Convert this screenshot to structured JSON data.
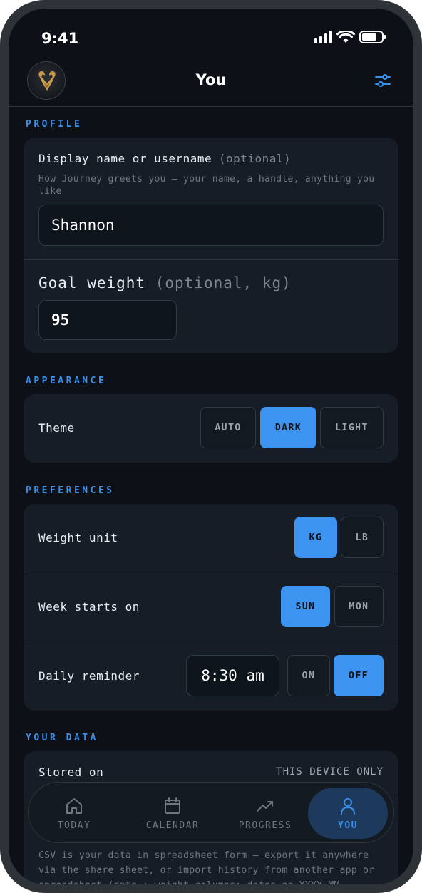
{
  "status_bar": {
    "time": "9:41"
  },
  "header": {
    "title": "You"
  },
  "profile": {
    "section_label": "PROFILE",
    "display_name_label": "Display name or username",
    "display_name_optional": "(optional)",
    "display_name_helper": "How Journey greets you — your name, a handle, anything you like",
    "display_name_value": "Shannon",
    "goal_weight_label": "Goal weight",
    "goal_weight_optional": "(optional, kg)",
    "goal_weight_value": "95"
  },
  "appearance": {
    "section_label": "APPEARANCE",
    "theme_label": "Theme",
    "theme_options": [
      "AUTO",
      "DARK",
      "LIGHT"
    ],
    "theme_selected": "DARK"
  },
  "preferences": {
    "section_label": "PREFERENCES",
    "weight_unit_label": "Weight unit",
    "weight_unit_options": [
      "KG",
      "LB"
    ],
    "weight_unit_selected": "KG",
    "week_start_label": "Week starts on",
    "week_start_options": [
      "SUN",
      "MON"
    ],
    "week_start_selected": "SUN",
    "reminder_label": "Daily reminder",
    "reminder_time": "8:30 am",
    "reminder_options": [
      "ON",
      "OFF"
    ],
    "reminder_selected": "OFF"
  },
  "your_data": {
    "section_label": "YOUR DATA",
    "stored_on_label": "Stored on",
    "stored_on_value": "THIS DEVICE ONLY",
    "csv_helper": "CSV is your data in spreadsheet form — export it anywhere via the share sheet, or import history from another app or spreadsheet (date + weight columns; dates as YYYY-MM"
  },
  "nav": {
    "items": [
      {
        "label": "TODAY",
        "icon": "home-icon"
      },
      {
        "label": "CALENDAR",
        "icon": "calendar-icon"
      },
      {
        "label": "PROGRESS",
        "icon": "trend-icon"
      },
      {
        "label": "YOU",
        "icon": "person-icon"
      }
    ],
    "active": "YOU"
  },
  "colors": {
    "accent": "#3d94f0",
    "background": "#0d1117",
    "card": "#161d26"
  }
}
